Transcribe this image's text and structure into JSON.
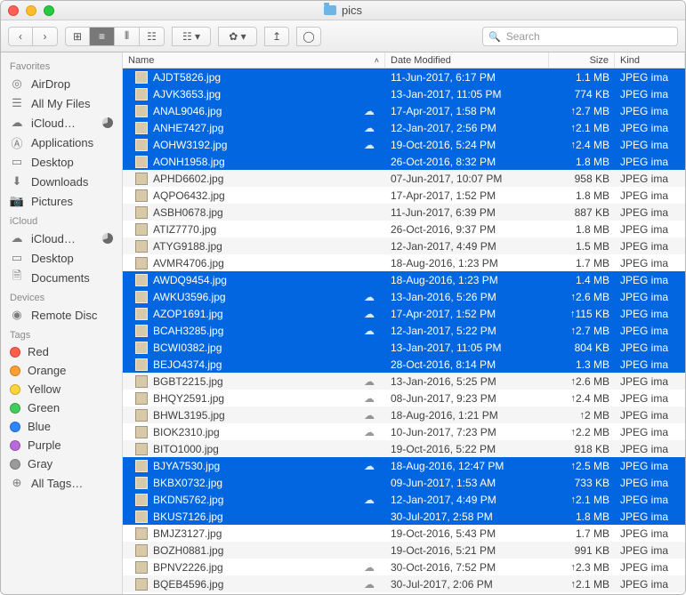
{
  "title": "pics",
  "search_placeholder": "Search",
  "toolbar": {
    "back": "‹",
    "fwd": "›",
    "views": [
      "⊞",
      "≡",
      "⫴",
      "☷"
    ],
    "arrange": "☷ ▾",
    "action": "✿ ▾",
    "share": "↥",
    "tags": "◯"
  },
  "sidebar": {
    "favorites_head": "Favorites",
    "favorites": [
      {
        "icon": "◎",
        "label": "AirDrop"
      },
      {
        "icon": "☰",
        "label": "All My Files"
      },
      {
        "icon": "☁",
        "label": "iCloud…",
        "pie": true
      },
      {
        "icon": "Ⓐ",
        "label": "Applications"
      },
      {
        "icon": "▭",
        "label": "Desktop"
      },
      {
        "icon": "⬇",
        "label": "Downloads"
      },
      {
        "icon": "📷",
        "label": "Pictures"
      }
    ],
    "icloud_head": "iCloud",
    "icloud": [
      {
        "icon": "☁",
        "label": "iCloud…",
        "pie": true
      },
      {
        "icon": "▭",
        "label": "Desktop"
      },
      {
        "icon": "🗎",
        "label": "Documents"
      }
    ],
    "devices_head": "Devices",
    "devices": [
      {
        "icon": "◉",
        "label": "Remote Disc"
      }
    ],
    "tags_head": "Tags",
    "tags": [
      {
        "color": "#ff5e4c",
        "label": "Red"
      },
      {
        "color": "#ff9f2e",
        "label": "Orange"
      },
      {
        "color": "#ffd53a",
        "label": "Yellow"
      },
      {
        "color": "#42cc5e",
        "label": "Green"
      },
      {
        "color": "#2f84ff",
        "label": "Blue"
      },
      {
        "color": "#b76bd8",
        "label": "Purple"
      },
      {
        "color": "#9a9a9a",
        "label": "Gray"
      },
      {
        "color": "",
        "label": "All Tags…",
        "all": true
      }
    ]
  },
  "columns": {
    "name": "Name",
    "date": "Date Modified",
    "size": "Size",
    "kind": "Kind"
  },
  "rows": [
    {
      "sel": true,
      "name": "AJDT5826.jpg",
      "cloud": false,
      "date": "11-Jun-2017, 6:17 PM",
      "up": false,
      "size": "1.1 MB",
      "kind": "JPEG ima"
    },
    {
      "sel": true,
      "name": "AJVK3653.jpg",
      "cloud": false,
      "date": "13-Jan-2017, 11:05 PM",
      "up": false,
      "size": "774 KB",
      "kind": "JPEG ima"
    },
    {
      "sel": true,
      "name": "ANAL9046.jpg",
      "cloud": true,
      "date": "17-Apr-2017, 1:58 PM",
      "up": true,
      "size": "2.7 MB",
      "kind": "JPEG ima"
    },
    {
      "sel": true,
      "name": "ANHE7427.jpg",
      "cloud": true,
      "date": "12-Jan-2017, 2:56 PM",
      "up": true,
      "size": "2.1 MB",
      "kind": "JPEG ima"
    },
    {
      "sel": true,
      "name": "AOHW3192.jpg",
      "cloud": true,
      "date": "19-Oct-2016, 5:24 PM",
      "up": true,
      "size": "2.4 MB",
      "kind": "JPEG ima"
    },
    {
      "sel": true,
      "name": "AONH1958.jpg",
      "cloud": false,
      "date": "26-Oct-2016, 8:32 PM",
      "up": false,
      "size": "1.8 MB",
      "kind": "JPEG ima"
    },
    {
      "sel": false,
      "name": "APHD6602.jpg",
      "cloud": false,
      "date": "07-Jun-2017, 10:07 PM",
      "up": false,
      "size": "958 KB",
      "kind": "JPEG ima"
    },
    {
      "sel": false,
      "name": "AQPO6432.jpg",
      "cloud": false,
      "date": "17-Apr-2017, 1:52 PM",
      "up": false,
      "size": "1.8 MB",
      "kind": "JPEG ima"
    },
    {
      "sel": false,
      "name": "ASBH0678.jpg",
      "cloud": false,
      "date": "11-Jun-2017, 6:39 PM",
      "up": false,
      "size": "887 KB",
      "kind": "JPEG ima"
    },
    {
      "sel": false,
      "name": "ATIZ7770.jpg",
      "cloud": false,
      "date": "26-Oct-2016, 9:37 PM",
      "up": false,
      "size": "1.8 MB",
      "kind": "JPEG ima"
    },
    {
      "sel": false,
      "name": "ATYG9188.jpg",
      "cloud": false,
      "date": "12-Jan-2017, 4:49 PM",
      "up": false,
      "size": "1.5 MB",
      "kind": "JPEG ima"
    },
    {
      "sel": false,
      "name": "AVMR4706.jpg",
      "cloud": false,
      "date": "18-Aug-2016, 1:23 PM",
      "up": false,
      "size": "1.7 MB",
      "kind": "JPEG ima"
    },
    {
      "sel": true,
      "name": "AWDQ9454.jpg",
      "cloud": false,
      "date": "18-Aug-2016, 1:23 PM",
      "up": false,
      "size": "1.4 MB",
      "kind": "JPEG ima"
    },
    {
      "sel": true,
      "name": "AWKU3596.jpg",
      "cloud": true,
      "date": "13-Jan-2016, 5:26 PM",
      "up": true,
      "size": "2.6 MB",
      "kind": "JPEG ima"
    },
    {
      "sel": true,
      "name": "AZOP1691.jpg",
      "cloud": true,
      "date": "17-Apr-2017, 1:52 PM",
      "up": true,
      "size": "115 KB",
      "kind": "JPEG ima"
    },
    {
      "sel": true,
      "name": "BCAH3285.jpg",
      "cloud": true,
      "date": "12-Jan-2017, 5:22 PM",
      "up": true,
      "size": "2.7 MB",
      "kind": "JPEG ima"
    },
    {
      "sel": true,
      "name": "BCWI0382.jpg",
      "cloud": false,
      "date": "13-Jan-2017, 11:05 PM",
      "up": false,
      "size": "804 KB",
      "kind": "JPEG ima"
    },
    {
      "sel": true,
      "name": "BEJO4374.jpg",
      "cloud": false,
      "date": "28-Oct-2016, 8:14 PM",
      "up": false,
      "size": "1.3 MB",
      "kind": "JPEG ima"
    },
    {
      "sel": false,
      "name": "BGBT2215.jpg",
      "cloud": true,
      "date": "13-Jan-2016, 5:25 PM",
      "up": true,
      "size": "2.6 MB",
      "kind": "JPEG ima"
    },
    {
      "sel": false,
      "name": "BHQY2591.jpg",
      "cloud": true,
      "date": "08-Jun-2017, 9:23 PM",
      "up": true,
      "size": "2.4 MB",
      "kind": "JPEG ima"
    },
    {
      "sel": false,
      "name": "BHWL3195.jpg",
      "cloud": true,
      "date": "18-Aug-2016, 1:21 PM",
      "up": true,
      "size": "2 MB",
      "kind": "JPEG ima"
    },
    {
      "sel": false,
      "name": "BIOK2310.jpg",
      "cloud": true,
      "date": "10-Jun-2017, 7:23 PM",
      "up": true,
      "size": "2.2 MB",
      "kind": "JPEG ima"
    },
    {
      "sel": false,
      "name": "BITO1000.jpg",
      "cloud": false,
      "date": "19-Oct-2016, 5:22 PM",
      "up": false,
      "size": "918 KB",
      "kind": "JPEG ima"
    },
    {
      "sel": true,
      "name": "BJYA7530.jpg",
      "cloud": true,
      "date": "18-Aug-2016, 12:47 PM",
      "up": true,
      "size": "2.5 MB",
      "kind": "JPEG ima"
    },
    {
      "sel": true,
      "name": "BKBX0732.jpg",
      "cloud": false,
      "date": "09-Jun-2017, 1:53 AM",
      "up": false,
      "size": "733 KB",
      "kind": "JPEG ima"
    },
    {
      "sel": true,
      "name": "BKDN5762.jpg",
      "cloud": true,
      "date": "12-Jan-2017, 4:49 PM",
      "up": true,
      "size": "2.1 MB",
      "kind": "JPEG ima"
    },
    {
      "sel": true,
      "name": "BKUS7126.jpg",
      "cloud": false,
      "date": "30-Jul-2017, 2:58 PM",
      "up": false,
      "size": "1.8 MB",
      "kind": "JPEG ima"
    },
    {
      "sel": false,
      "name": "BMJZ3127.jpg",
      "cloud": false,
      "date": "19-Oct-2016, 5:43 PM",
      "up": false,
      "size": "1.7 MB",
      "kind": "JPEG ima"
    },
    {
      "sel": false,
      "name": "BOZH0881.jpg",
      "cloud": false,
      "date": "19-Oct-2016, 5:21 PM",
      "up": false,
      "size": "991 KB",
      "kind": "JPEG ima"
    },
    {
      "sel": false,
      "name": "BPNV2226.jpg",
      "cloud": true,
      "date": "30-Oct-2016, 7:52 PM",
      "up": true,
      "size": "2.3 MB",
      "kind": "JPEG ima"
    },
    {
      "sel": false,
      "name": "BQEB4596.jpg",
      "cloud": true,
      "date": "30-Jul-2017, 2:06 PM",
      "up": true,
      "size": "2.1 MB",
      "kind": "JPEG ima"
    }
  ]
}
